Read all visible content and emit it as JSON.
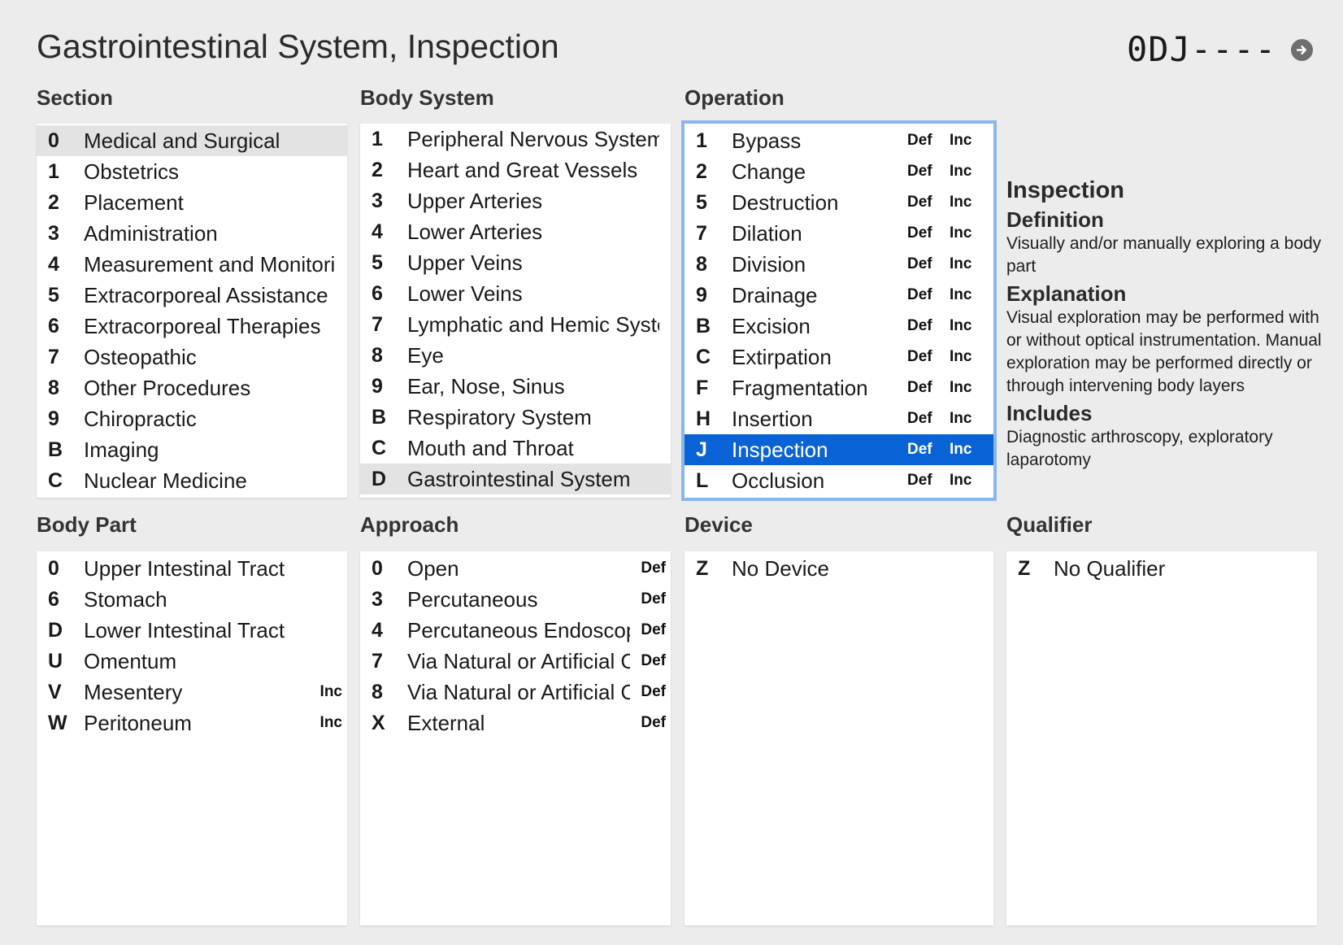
{
  "header": {
    "title": "Gastrointestinal System, Inspection",
    "code": "0DJ----"
  },
  "icons": {
    "go": "arrow-right-circle-icon"
  },
  "columns": {
    "section": "Section",
    "body_system": "Body System",
    "operation": "Operation",
    "body_part": "Body Part",
    "approach": "Approach",
    "device": "Device",
    "qualifier": "Qualifier"
  },
  "section": {
    "selected_code": "0",
    "items": [
      {
        "code": "0",
        "label": "Medical and Surgical"
      },
      {
        "code": "1",
        "label": "Obstetrics"
      },
      {
        "code": "2",
        "label": "Placement"
      },
      {
        "code": "3",
        "label": "Administration"
      },
      {
        "code": "4",
        "label": "Measurement and Monitoring"
      },
      {
        "code": "5",
        "label": "Extracorporeal Assistance"
      },
      {
        "code": "6",
        "label": "Extracorporeal Therapies"
      },
      {
        "code": "7",
        "label": "Osteopathic"
      },
      {
        "code": "8",
        "label": "Other Procedures"
      },
      {
        "code": "9",
        "label": "Chiropractic"
      },
      {
        "code": "B",
        "label": "Imaging"
      },
      {
        "code": "C",
        "label": "Nuclear Medicine"
      }
    ]
  },
  "body_system": {
    "selected_code": "D",
    "items": [
      {
        "code": "1",
        "label": "Peripheral Nervous System"
      },
      {
        "code": "2",
        "label": "Heart and Great Vessels"
      },
      {
        "code": "3",
        "label": "Upper Arteries"
      },
      {
        "code": "4",
        "label": "Lower Arteries"
      },
      {
        "code": "5",
        "label": "Upper Veins"
      },
      {
        "code": "6",
        "label": "Lower Veins"
      },
      {
        "code": "7",
        "label": "Lymphatic and Hemic Systems"
      },
      {
        "code": "8",
        "label": "Eye"
      },
      {
        "code": "9",
        "label": "Ear, Nose, Sinus"
      },
      {
        "code": "B",
        "label": "Respiratory System"
      },
      {
        "code": "C",
        "label": "Mouth and Throat"
      },
      {
        "code": "D",
        "label": "Gastrointestinal System"
      }
    ]
  },
  "operation": {
    "selected_code": "J",
    "def_label": "Def",
    "inc_label": "Inc",
    "items": [
      {
        "code": "1",
        "label": "Bypass"
      },
      {
        "code": "2",
        "label": "Change"
      },
      {
        "code": "5",
        "label": "Destruction"
      },
      {
        "code": "7",
        "label": "Dilation"
      },
      {
        "code": "8",
        "label": "Division"
      },
      {
        "code": "9",
        "label": "Drainage"
      },
      {
        "code": "B",
        "label": "Excision"
      },
      {
        "code": "C",
        "label": "Extirpation"
      },
      {
        "code": "F",
        "label": "Fragmentation"
      },
      {
        "code": "H",
        "label": "Insertion"
      },
      {
        "code": "J",
        "label": "Inspection"
      },
      {
        "code": "L",
        "label": "Occlusion"
      }
    ]
  },
  "info": {
    "title": "Inspection",
    "definition_heading": "Definition",
    "definition": "Visually and/or manually exploring a body part",
    "explanation_heading": "Explanation",
    "explanation": "Visual exploration may be performed with or without optical instrumentation. Manual exploration may be performed directly or through intervening body layers",
    "includes_heading": "Includes",
    "includes": "Diagnostic arthroscopy, exploratory laparotomy"
  },
  "body_part": {
    "items": [
      {
        "code": "0",
        "label": "Upper Intestinal Tract",
        "tag": ""
      },
      {
        "code": "6",
        "label": "Stomach",
        "tag": ""
      },
      {
        "code": "D",
        "label": "Lower Intestinal Tract",
        "tag": ""
      },
      {
        "code": "U",
        "label": "Omentum",
        "tag": ""
      },
      {
        "code": "V",
        "label": "Mesentery",
        "tag": "Inc"
      },
      {
        "code": "W",
        "label": "Peritoneum",
        "tag": "Inc"
      }
    ]
  },
  "approach": {
    "items": [
      {
        "code": "0",
        "label": "Open",
        "tag": "Def"
      },
      {
        "code": "3",
        "label": "Percutaneous",
        "tag": "Def"
      },
      {
        "code": "4",
        "label": "Percutaneous Endoscopic",
        "tag": "Def"
      },
      {
        "code": "7",
        "label": "Via Natural or Artificial Opening",
        "tag": "Def"
      },
      {
        "code": "8",
        "label": "Via Natural or Artificial Opening Endoscopic",
        "tag": "Def"
      },
      {
        "code": "X",
        "label": "External",
        "tag": "Def"
      }
    ]
  },
  "device": {
    "items": [
      {
        "code": "Z",
        "label": "No Device",
        "tag": ""
      }
    ]
  },
  "qualifier": {
    "items": [
      {
        "code": "Z",
        "label": "No Qualifier",
        "tag": ""
      }
    ]
  }
}
